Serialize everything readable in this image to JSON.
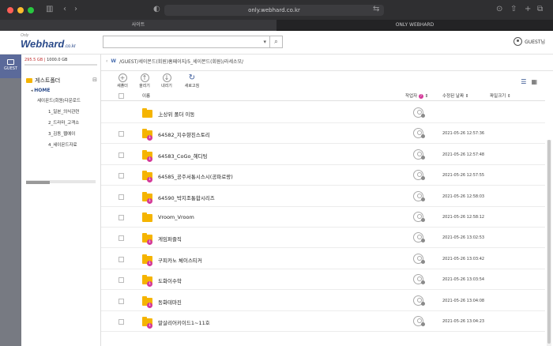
{
  "browser": {
    "address": "only.webhard.co.kr",
    "tabs": [
      {
        "label": "사이트",
        "active": true
      },
      {
        "label": "ONLY WEBHARD",
        "active": false
      }
    ]
  },
  "header": {
    "logo_only": "Only",
    "logo_main": "Webhard",
    "logo_sub": ".co.kr",
    "search_placeholder": "",
    "user_label": "GUEST님"
  },
  "rail": {
    "label": "GUEST"
  },
  "folders": {
    "storage_used": "295.5 GB",
    "storage_total": "1000.0 GB",
    "tree_title": "게스트폴더",
    "home": "HOME",
    "items": [
      "세이몬드(회원)다운로드",
      "1_일본_의식관련",
      "2_드라마_고객소",
      "3_김동_웹예이",
      "4_세이몬드자료"
    ]
  },
  "main": {
    "breadcrumb": [
      "W",
      "/GUEST/세이몬드(회원)홈페이지/5_세이몬드(회원)/라세소모/"
    ],
    "tools": [
      {
        "label": "새폴더",
        "icon": "plus-icon"
      },
      {
        "label": "올리기",
        "icon": "upload-icon"
      },
      {
        "label": "내리기",
        "icon": "download-icon"
      },
      {
        "label": "새로고침",
        "icon": "refresh-icon"
      }
    ],
    "columns": {
      "name": "이름",
      "owner": "작업자",
      "modified": "수정된 날짜",
      "size": "파일크기"
    },
    "rows": [
      {
        "name": "上상위 폴더 이동",
        "date": "",
        "badge": false
      },
      {
        "name": "64582_지수향친스토리",
        "date": "2021-05-26 12:57:36",
        "badge": true
      },
      {
        "name": "64583_CoGo_헤디팅",
        "date": "2021-05-26 12:57:48",
        "badge": true
      },
      {
        "name": "64585_공주서통시스시(공파로랑)",
        "date": "2021-05-26 12:57:55",
        "badge": true
      },
      {
        "name": "64590_박지조통합시리즈",
        "date": "2021-05-26 12:58:03",
        "badge": true
      },
      {
        "name": "Vroom_Vroom",
        "date": "2021-05-26 12:58:12",
        "badge": false
      },
      {
        "name": "게임퍼즐직",
        "date": "2021-05-26 13:02:53",
        "badge": true
      },
      {
        "name": "구피카노 체이스티커",
        "date": "2021-05-26 13:03:42",
        "badge": true
      },
      {
        "name": "도화이수학",
        "date": "2021-05-26 13:03:54",
        "badge": true
      },
      {
        "name": "동화테마진",
        "date": "2021-05-26 13:04:08",
        "badge": true
      },
      {
        "name": "말살리어키이드1~11호",
        "date": "2021-05-26 13:04:23",
        "badge": true
      }
    ]
  }
}
